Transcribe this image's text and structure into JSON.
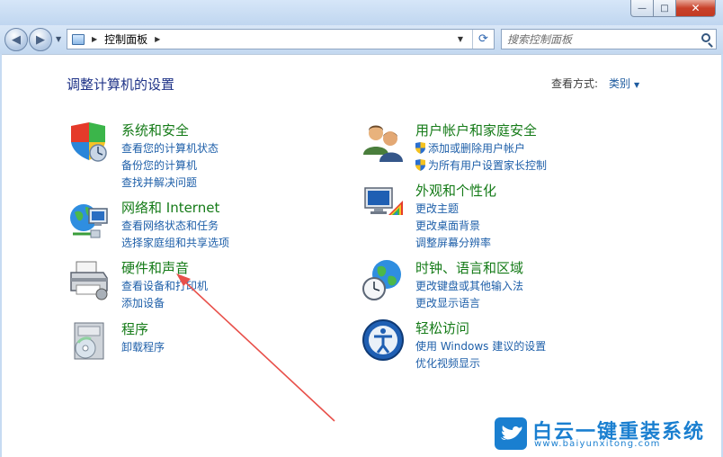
{
  "window": {
    "minimize_label": "—",
    "maximize_label": "□",
    "close_label": "✕"
  },
  "navbar": {
    "breadcrumb": [
      "控制面板"
    ],
    "search_placeholder": "搜索控制面板"
  },
  "header": {
    "title": "调整计算机的设置",
    "view_by_label": "查看方式:",
    "view_by_value": "类别"
  },
  "categories": [
    {
      "title": "系统和安全",
      "icon": "system-security-icon",
      "links": [
        "查看您的计算机状态",
        "备份您的计算机",
        "查找并解决问题"
      ]
    },
    {
      "title": "网络和 Internet",
      "icon": "network-internet-icon",
      "links": [
        "查看网络状态和任务",
        "选择家庭组和共享选项"
      ]
    },
    {
      "title": "硬件和声音",
      "icon": "hardware-sound-icon",
      "links": [
        "查看设备和打印机",
        "添加设备"
      ]
    },
    {
      "title": "程序",
      "icon": "programs-icon",
      "links": [
        "卸载程序"
      ]
    },
    {
      "title": "用户帐户和家庭安全",
      "icon": "user-accounts-icon",
      "links": [
        "添加或删除用户帐户",
        "为所有用户设置家长控制"
      ]
    },
    {
      "title": "外观和个性化",
      "icon": "appearance-icon",
      "links": [
        "更改主题",
        "更改桌面背景",
        "调整屏幕分辨率"
      ]
    },
    {
      "title": "时钟、语言和区域",
      "icon": "clock-region-icon",
      "links": [
        "更改键盘或其他输入法",
        "更改显示语言"
      ]
    },
    {
      "title": "轻松访问",
      "icon": "ease-of-access-icon",
      "links": [
        "使用 Windows 建议的设置",
        "优化视频显示"
      ]
    }
  ],
  "watermark": {
    "title": "白云一键重装系统",
    "url": "www.baiyunxitong.com"
  },
  "colors": {
    "category_title": "#157b18",
    "link": "#1e5fa9",
    "page_title": "#1e3287",
    "annotation_arrow": "#e8504a"
  }
}
